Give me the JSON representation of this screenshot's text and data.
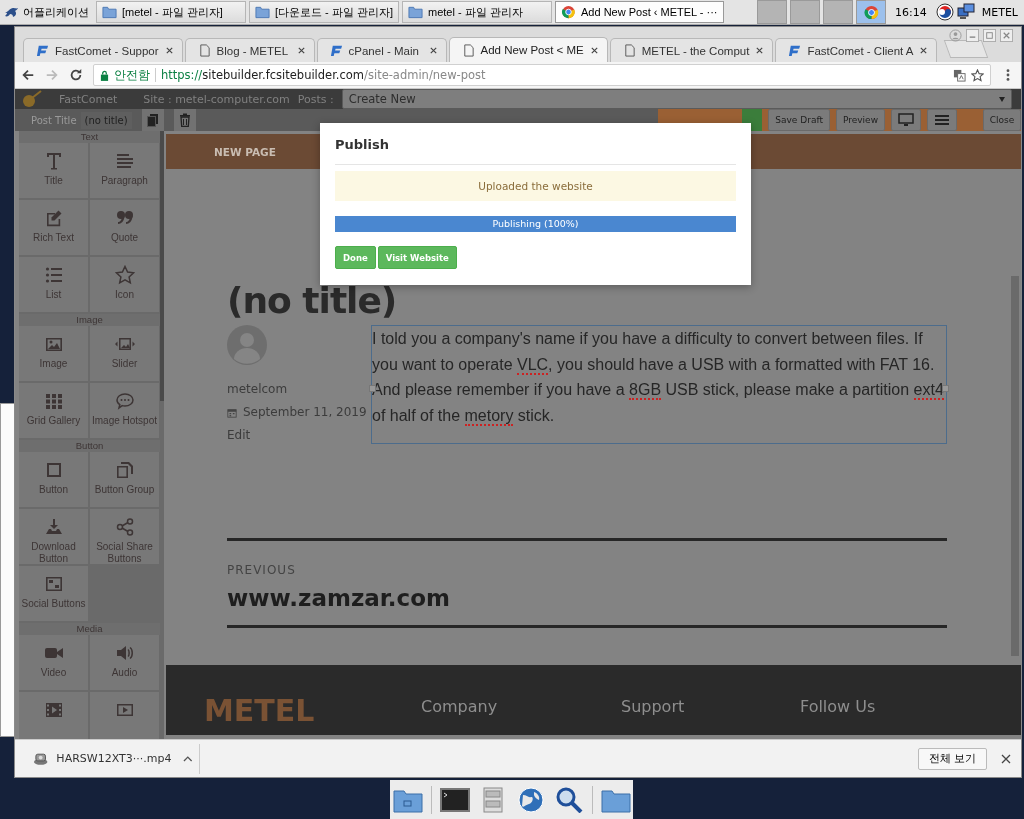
{
  "taskbar": {
    "app_menu": "어플리케이션",
    "tasks": [
      {
        "label": "[metel - 파일 관리자]",
        "selected": false
      },
      {
        "label": "[다운로드 - 파일 관리자]",
        "selected": false
      },
      {
        "label": "metel - 파일 관리자",
        "selected": false
      },
      {
        "label": "Add New Post ‹ METEL - ···",
        "selected": true
      }
    ],
    "clock": "16:14",
    "user": "METEL"
  },
  "browser": {
    "tabs": [
      {
        "title": "FastComet - Suppor",
        "selected": false
      },
      {
        "title": "Blog - METEL",
        "selected": false
      },
      {
        "title": "cPanel - Main",
        "selected": false
      },
      {
        "title": "Add New Post < ME",
        "selected": true
      },
      {
        "title": "METEL - the Comput",
        "selected": false
      },
      {
        "title": "FastComet - Client A",
        "selected": false
      }
    ],
    "address": {
      "security": "안전함",
      "scheme": "https://",
      "host": "sitebuilder.fcsitebuilder.com",
      "path": "/site-admin/new-post"
    }
  },
  "editor": {
    "brand": "FastComet",
    "site": "Site : metel-computer.com",
    "posts_label": "Posts :",
    "posts_value": "Create New",
    "post_title_label": "Post Title",
    "post_title": "(no title)",
    "buttons": [
      "Save Draft",
      "Preview",
      "Close"
    ]
  },
  "sidebar": {
    "sections": [
      {
        "title": "Text",
        "items": [
          {
            "kind": "tile",
            "label": "Title"
          },
          {
            "kind": "tile",
            "label": "Paragraph"
          },
          {
            "kind": "tile",
            "label": "Rich Text"
          },
          {
            "kind": "tile",
            "label": "Quote"
          },
          {
            "kind": "tile",
            "label": "List"
          },
          {
            "kind": "tile",
            "label": "Icon"
          }
        ]
      },
      {
        "title": "Image",
        "items": [
          {
            "kind": "tile",
            "label": "Image"
          },
          {
            "kind": "tile",
            "label": "Slider"
          },
          {
            "kind": "tile",
            "label": "Grid Gallery"
          },
          {
            "kind": "tile",
            "label": "Image Hotspot"
          }
        ]
      },
      {
        "title": "Button",
        "items": [
          {
            "kind": "tile",
            "label": "Button"
          },
          {
            "kind": "tile",
            "label": "Button Group"
          },
          {
            "kind": "tile",
            "label": "Download Button"
          },
          {
            "kind": "tile",
            "label": "Social Share Buttons"
          },
          {
            "kind": "tile",
            "label": "Social Buttons"
          }
        ]
      },
      {
        "title": "Media",
        "items": [
          {
            "kind": "tile",
            "label": "Video"
          },
          {
            "kind": "tile",
            "label": "Audio"
          },
          {
            "kind": "partial"
          },
          {
            "kind": "partial"
          }
        ]
      }
    ]
  },
  "page": {
    "nav": "NEW PAGE",
    "title": "(no title)",
    "author": "metelcom",
    "date": "September 11, 2019",
    "edit": "Edit",
    "body": [
      {
        "text": "I told you a company's name if you have a difficulty to convert between files. If you want to operate ",
        "misspelled": false
      },
      {
        "text": "VLC",
        "misspelled": true
      },
      {
        "text": ", you should have a USB with a formatted with FAT 16. And please remember if you have a ",
        "misspelled": false
      },
      {
        "text": "8GB",
        "misspelled": true
      },
      {
        "text": " USB stick, please make a partition ",
        "misspelled": false
      },
      {
        "text": "ext4",
        "misspelled": true
      },
      {
        "text": " of half of the ",
        "misspelled": false
      },
      {
        "text": "metory",
        "misspelled": true
      },
      {
        "text": " stick.",
        "misspelled": false
      }
    ],
    "previous_label": "PREVIOUS",
    "previous_title": "www.zamzar.com",
    "footer": {
      "brand": "METEL",
      "columns": [
        "Company",
        "Support",
        "Follow Us"
      ]
    }
  },
  "modal": {
    "title": "Publish",
    "alert": "Uploaded the website",
    "progress": {
      "label": "Publishing (100%)",
      "level": 1
    },
    "buttons": [
      "Done",
      "Visit Website"
    ]
  },
  "downloads": {
    "file": "HARSW12XT3···.mp4",
    "show_all": "전체 보기"
  }
}
